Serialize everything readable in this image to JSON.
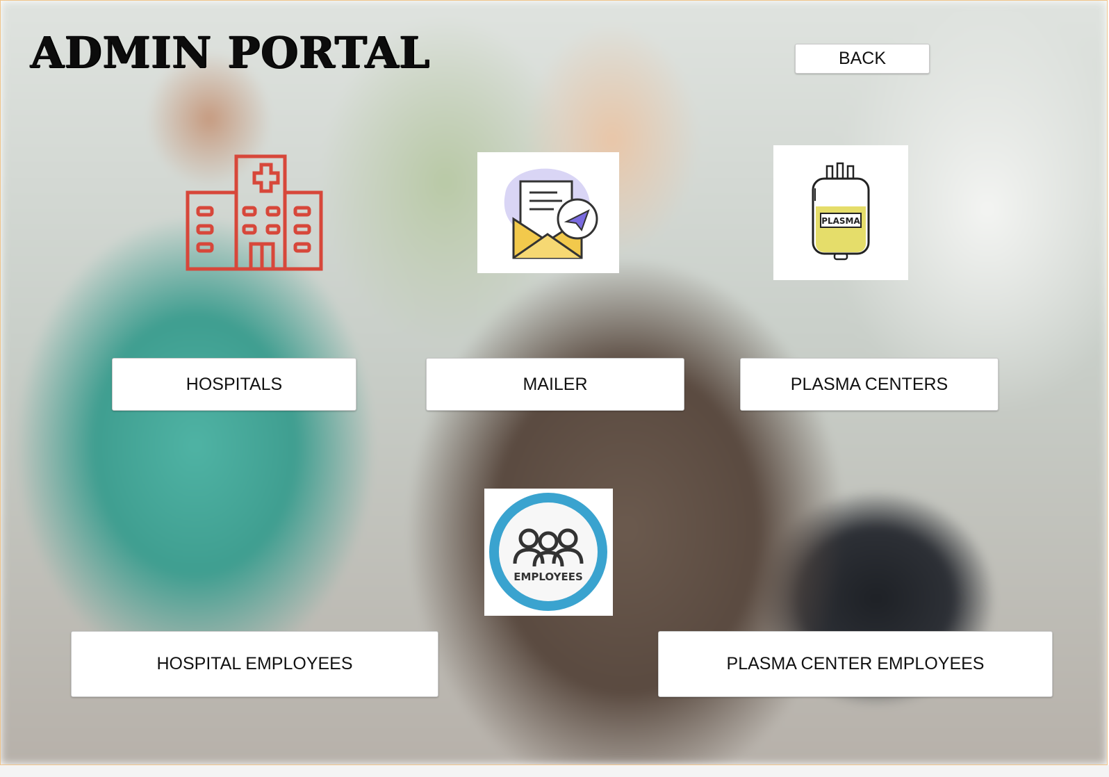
{
  "header": {
    "title": "ADMIN PORTAL",
    "back_label": "BACK"
  },
  "tiles": {
    "hospitals": {
      "label": "HOSPITALS",
      "icon": "hospital-building-icon"
    },
    "mailer": {
      "label": "MAILER",
      "icon": "mail-envelope-icon"
    },
    "plasma_centers": {
      "label": "PLASMA CENTERS",
      "icon": "plasma-bag-icon",
      "icon_text": "PLASMA"
    },
    "hospital_employees": {
      "label": "HOSPITAL EMPLOYEES"
    },
    "plasma_center_employees": {
      "label": "PLASMA CENTER EMPLOYEES"
    },
    "employees_icon": {
      "icon": "employees-group-icon",
      "icon_text": "EMPLOYEES"
    }
  },
  "colors": {
    "hospital_icon": "#d7473a",
    "plasma_fill": "#e5dd6a",
    "employees_ring": "#3aa3cf",
    "mail_blob": "#d9d5f5"
  }
}
